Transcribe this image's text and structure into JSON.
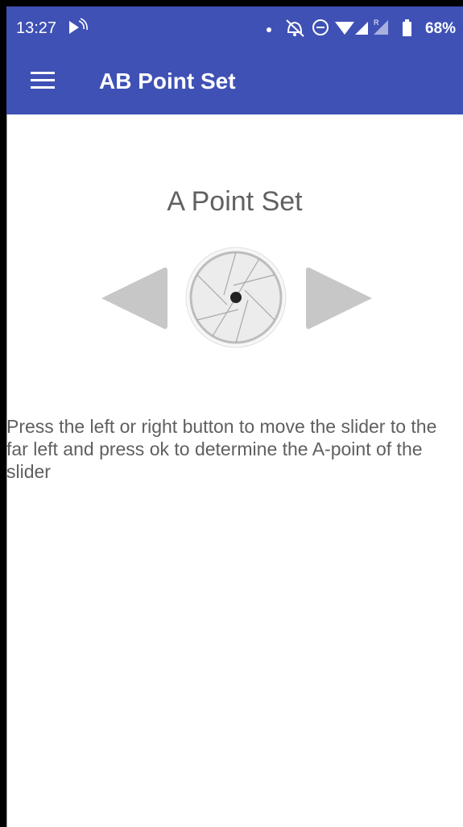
{
  "status_bar": {
    "time": "13:27",
    "battery": "68%",
    "icons": [
      "cast-icon",
      "notification-dot-icon",
      "bell-off-icon",
      "do-not-disturb-icon",
      "wifi-icon",
      "cell-signal-icon",
      "cell-signal-roaming-icon",
      "battery-icon"
    ]
  },
  "app_bar": {
    "menu_icon": "menu-icon",
    "title": "AB Point Set"
  },
  "main": {
    "section_title": "A Point Set",
    "left_button_icon": "left-arrow-icon",
    "ok_button_icon": "aperture-icon",
    "right_button_icon": "right-arrow-icon",
    "instruction": "Press the left or right button to move the slider to the far left and press ok to determine the A-point of the slider"
  },
  "colors": {
    "app_bar": "#3f51b5",
    "title_text": "#616161",
    "body_text": "#5f5f5f",
    "arrow": "#c7c7c7"
  }
}
